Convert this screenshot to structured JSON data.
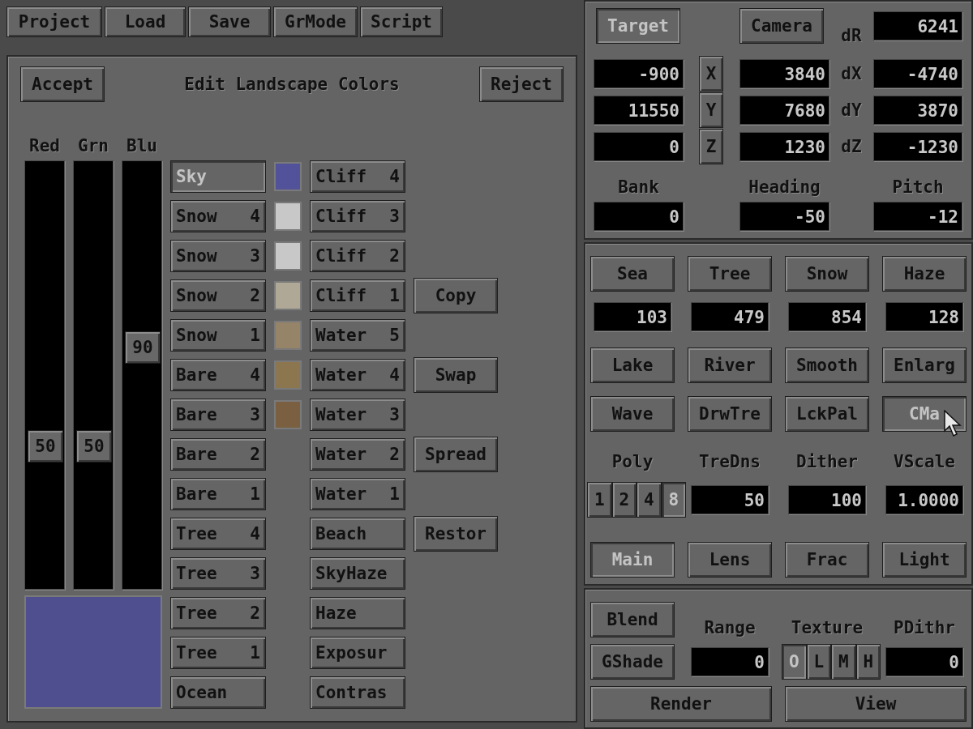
{
  "toolbar": [
    "Project",
    "Load",
    "Save",
    "GrMode",
    "Script"
  ],
  "color_editor": {
    "title": "Edit Landscape Colors",
    "accept": "Accept",
    "reject": "Reject",
    "sliders": [
      {
        "label": "Red",
        "level": 0.32,
        "reading": "50"
      },
      {
        "label": "Grn",
        "level": 0.32,
        "reading": "50"
      },
      {
        "label": "Blu",
        "level": 0.57,
        "reading": "90"
      }
    ],
    "preview": {
      "color": "#4f4f8f"
    },
    "left_column": [
      {
        "name": "Sky",
        "selected": true,
        "color": "#52529a"
      },
      {
        "name": "Snow",
        "number": "4",
        "selected": false,
        "color": "#c8c8c8"
      },
      {
        "name": "Snow",
        "number": "3",
        "selected": false,
        "color": "#c8c8c8"
      },
      {
        "name": "Snow",
        "number": "2",
        "selected": false,
        "color": "#b0a896"
      },
      {
        "name": "Snow",
        "number": "1",
        "selected": false,
        "color": "#968468"
      },
      {
        "name": "Bare",
        "number": "4",
        "selected": false,
        "color": "#8c7650"
      },
      {
        "name": "Bare",
        "number": "3",
        "selected": false,
        "color": "#7a6040"
      },
      {
        "name": "Bare",
        "number": "2",
        "selected": false
      },
      {
        "name": "Bare",
        "number": "1",
        "selected": false
      },
      {
        "name": "Tree",
        "number": "4",
        "selected": false
      },
      {
        "name": "Tree",
        "number": "3",
        "selected": false
      },
      {
        "name": "Tree",
        "number": "2",
        "selected": false
      },
      {
        "name": "Tree",
        "number": "1",
        "selected": false
      },
      {
        "name": "Ocean",
        "selected": false
      }
    ],
    "right_column": [
      {
        "name": "Cliff",
        "number": "4",
        "selected": false
      },
      {
        "name": "Cliff",
        "number": "3",
        "selected": false
      },
      {
        "name": "Cliff",
        "number": "2",
        "selected": false
      },
      {
        "name": "Cliff",
        "number": "1",
        "selected": false
      },
      {
        "name": "Water",
        "number": "5",
        "selected": false
      },
      {
        "name": "Water",
        "number": "4",
        "selected": false
      },
      {
        "name": "Water",
        "number": "3",
        "selected": false
      },
      {
        "name": "Water",
        "number": "2",
        "selected": false
      },
      {
        "name": "Water",
        "number": "1",
        "selected": false
      },
      {
        "name": "Beach",
        "selected": false
      },
      {
        "name": "SkyHaze",
        "selected": false
      },
      {
        "name": "Haze",
        "selected": false
      },
      {
        "name": "Exposur",
        "selected": false
      },
      {
        "name": "Contras",
        "selected": false
      }
    ],
    "actions": [
      "Copy",
      "Swap",
      "Spread",
      "Restor"
    ]
  },
  "camera_panel": {
    "target": {
      "label": "Target",
      "selected": true
    },
    "camera": {
      "label": "Camera",
      "selected": false
    },
    "distance": {
      "label": "dR",
      "value": "6241"
    },
    "rows": [
      {
        "target": "-900",
        "axis": "X",
        "camera": "3840",
        "delta_label": "dX",
        "delta": "-4740"
      },
      {
        "target": "11550",
        "axis": "Y",
        "camera": "7680",
        "delta_label": "dY",
        "delta": "3870"
      },
      {
        "target": "0",
        "axis": "Z",
        "camera": "1230",
        "delta_label": "dZ",
        "delta": "-1230"
      }
    ],
    "angles": [
      {
        "label": "Bank",
        "value": "0"
      },
      {
        "label": "Heading",
        "value": "-50"
      },
      {
        "label": "Pitch",
        "value": "-12"
      }
    ]
  },
  "tools_panel": {
    "levels": [
      {
        "label": "Sea",
        "value": "103"
      },
      {
        "label": "Tree",
        "value": "479"
      },
      {
        "label": "Snow",
        "value": "854"
      },
      {
        "label": "Haze",
        "value": "128"
      }
    ],
    "toggles": [
      {
        "label": "Lake",
        "selected": false
      },
      {
        "label": "River",
        "selected": false
      },
      {
        "label": "Smooth",
        "selected": false
      },
      {
        "label": "Enlarg",
        "selected": false
      },
      {
        "label": "Wave",
        "selected": false
      },
      {
        "label": "DrwTre",
        "selected": false
      },
      {
        "label": "LckPal",
        "selected": false
      },
      {
        "label": "CMa",
        "selected": true
      }
    ],
    "poly": {
      "label": "Poly",
      "options": [
        {
          "label": "1",
          "selected": false
        },
        {
          "label": "2",
          "selected": false
        },
        {
          "label": "4",
          "selected": false
        },
        {
          "label": "8",
          "selected": true
        }
      ]
    },
    "settings": [
      {
        "label": "TreDns",
        "value": "50"
      },
      {
        "label": "Dither",
        "value": "100"
      },
      {
        "label": "VScale",
        "value": "1.0000"
      }
    ],
    "modes": [
      {
        "label": "Main",
        "selected": true
      },
      {
        "label": "Lens",
        "selected": false
      },
      {
        "label": "Frac",
        "selected": false
      },
      {
        "label": "Light",
        "selected": false
      }
    ]
  },
  "render_panel": {
    "blend": {
      "label": "Blend",
      "selected": false
    },
    "gshade": {
      "label": "GShade",
      "selected": false
    },
    "range": {
      "label": "Range",
      "value": "0"
    },
    "texture": {
      "label": "Texture",
      "options": [
        {
          "label": "O",
          "selected": true
        },
        {
          "label": "L",
          "selected": false
        },
        {
          "label": "M",
          "selected": false
        },
        {
          "label": "H",
          "selected": false
        }
      ]
    },
    "pdithr": {
      "label": "PDithr",
      "value": "0"
    },
    "render": "Render",
    "view": "View"
  }
}
